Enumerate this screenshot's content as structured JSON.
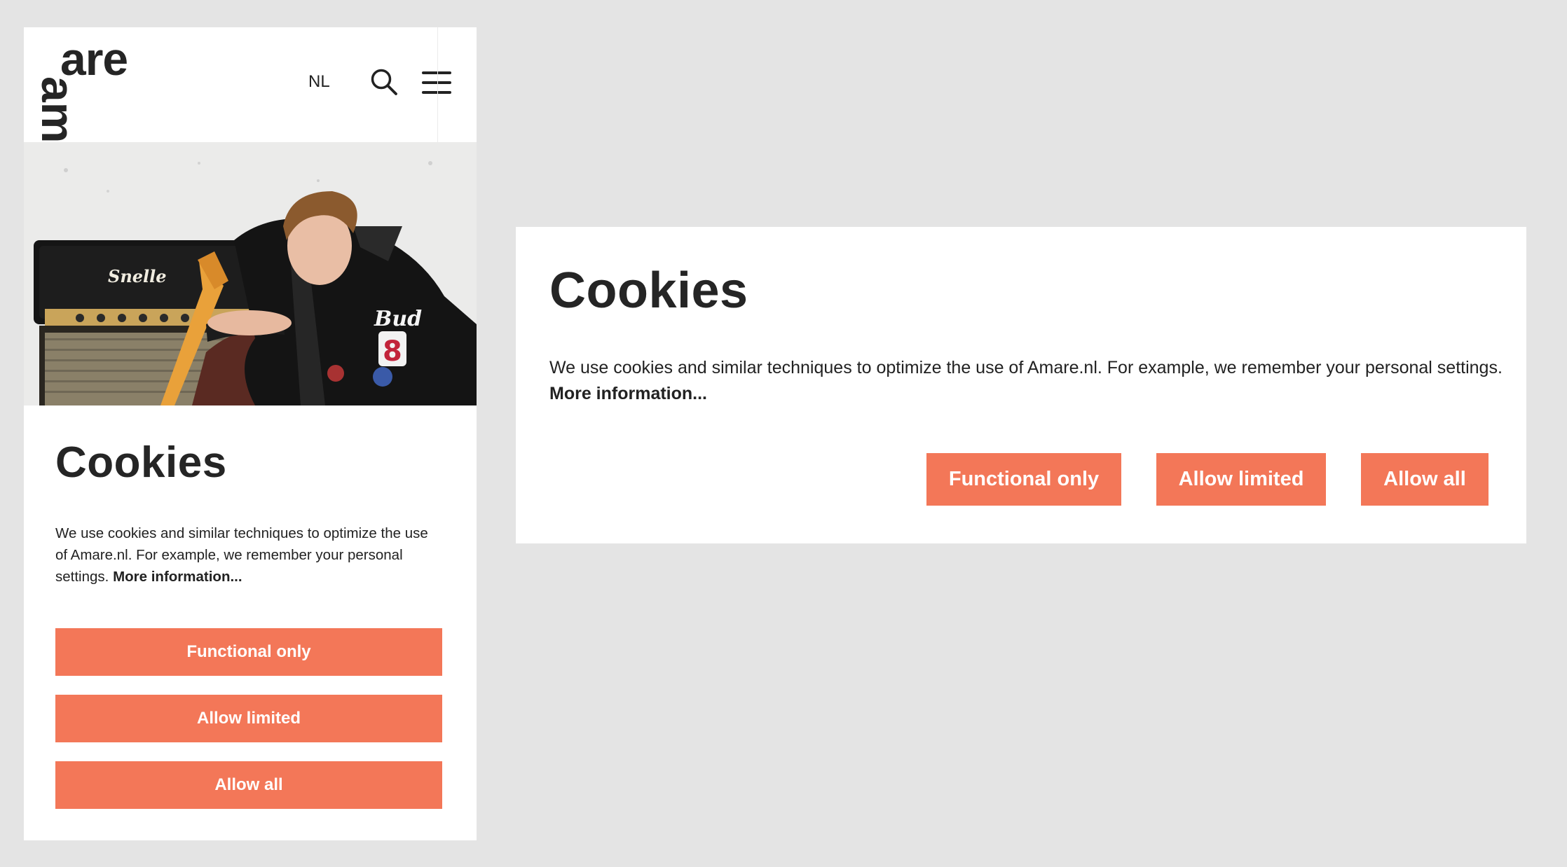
{
  "mobile": {
    "header": {
      "logo_text_top": "are",
      "logo_text_side": "am",
      "language": "NL",
      "icons": [
        "search-icon",
        "menu-icon"
      ]
    },
    "hero": {
      "amp_brand": "Snelle",
      "jacket_text": "Bud",
      "jacket_number": "8"
    },
    "cookie": {
      "title": "Cookies",
      "text": "We use cookies and similar techniques to optimize the use of Amare.nl. For example, we remember your personal settings.",
      "more_link": "More information...",
      "buttons": [
        "Functional only",
        "Allow limited",
        "Allow all"
      ]
    }
  },
  "desktop": {
    "cookie": {
      "title": "Cookies",
      "text": "We use cookies and similar techniques to optimize the use of Amare.nl. For example, we remember your personal settings.",
      "more_link": "More information...",
      "buttons": [
        "Functional only",
        "Allow limited",
        "Allow all"
      ]
    }
  },
  "colors": {
    "background": "#e4e4e4",
    "accent": "#f37758",
    "text": "#222222"
  }
}
